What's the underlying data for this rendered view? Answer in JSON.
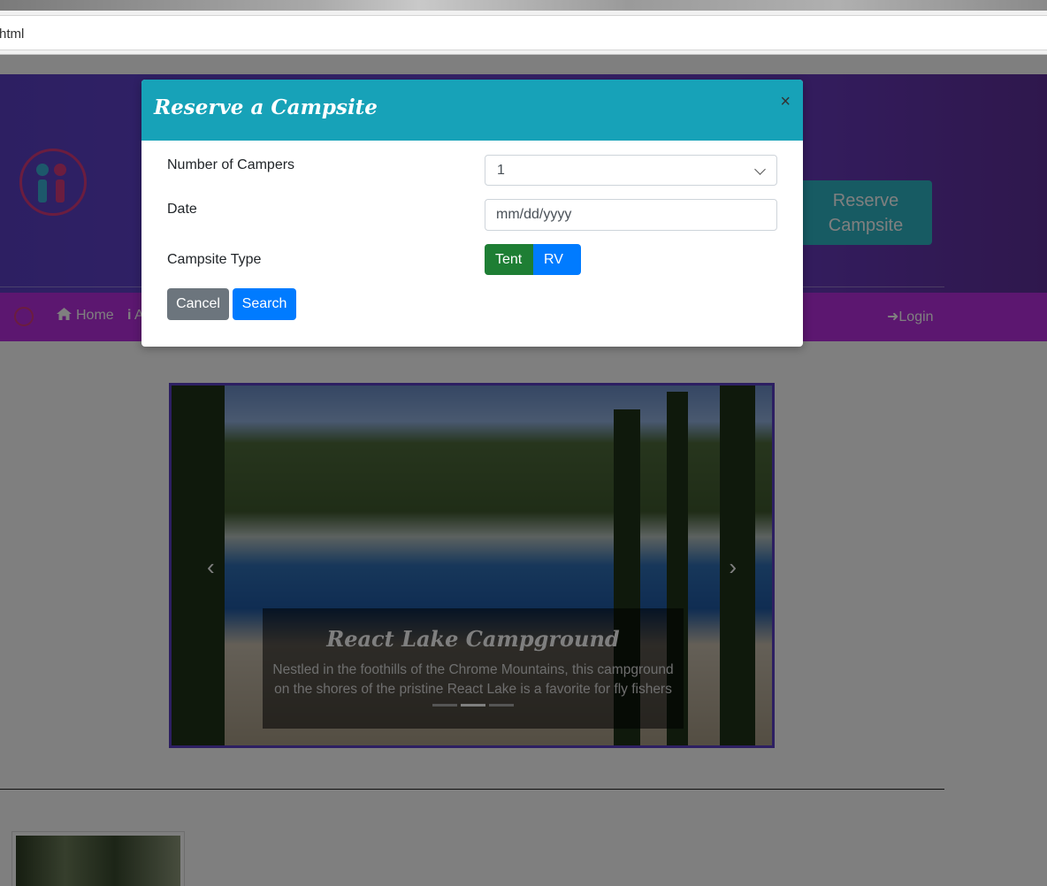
{
  "browser": {
    "url_fragment": "html"
  },
  "jumbotron": {
    "reserve_label_line1": "Reserve",
    "reserve_label_line2": "Campsite"
  },
  "navbar": {
    "home_label": "Home",
    "about_label_partial": "A",
    "login_label": "Login"
  },
  "carousel": {
    "caption_title": "React Lake Campground",
    "caption_text": "Nestled in the foothills of the Chrome Mountains, this campground on the shores of the pristine React Lake is a favorite for fly fishers",
    "prev_icon": "‹",
    "next_icon": "›",
    "indicators": 3,
    "active_indicator": 2
  },
  "modal": {
    "title": "Reserve a Campsite",
    "close_glyph": "×",
    "campers_label": "Number of Campers",
    "campers_value": "1",
    "date_label": "Date",
    "date_placeholder": "mm/dd/yyyy",
    "type_label": "Campsite Type",
    "type_options": [
      "Tent",
      "RV"
    ],
    "selected_type": "Tent",
    "cancel_label": "Cancel",
    "search_label": "Search"
  },
  "colors": {
    "modal_header": "#17a2b8",
    "primary": "#007bff",
    "success": "#1e7e34",
    "secondary": "#6c757d",
    "navbar": "#b82ee0"
  }
}
